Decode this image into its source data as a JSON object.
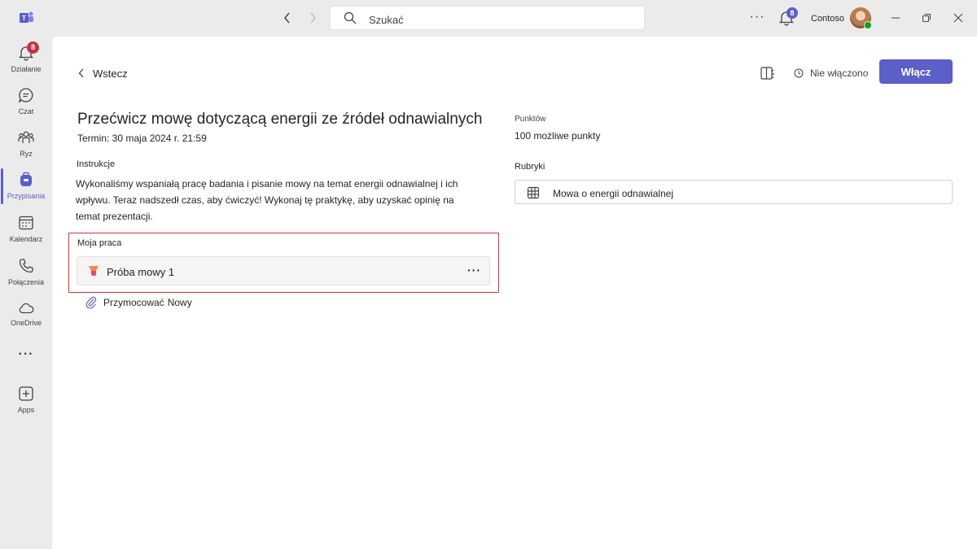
{
  "titlebar": {
    "search_placeholder": "Szukać",
    "notifications_count": "8",
    "org_name": "Contoso"
  },
  "rail": {
    "items": [
      {
        "label": "Działanie",
        "badge": "8"
      },
      {
        "label": "Czat"
      },
      {
        "label": "Ryz"
      },
      {
        "label": "Przypisania"
      },
      {
        "label": "Kalendarz"
      },
      {
        "label": "Połączenia"
      },
      {
        "label": "OneDrive"
      },
      {
        "label": "Apps"
      }
    ],
    "more_label": "···"
  },
  "header": {
    "back_label": "Wstecz",
    "status_label": "Nie włączono",
    "turn_in_label": "Włącz"
  },
  "assignment": {
    "title": "Przećwicz mowę dotyczącą energii ze źródeł odnawialnych",
    "due": "Termin: 30 maja 2024 r. 21:59",
    "instructions_label": "Instrukcje",
    "instructions_text": "Wykonaliśmy wspaniałą pracę badania i pisanie mowy na temat energii odnawialnej i ich wpływu. Teraz nadszedł czas, aby ćwiczyć! Wykonaj tę praktykę, aby uzyskać opinię na temat prezentacji.",
    "my_work_label": "Moja praca",
    "file_name": "Próba mowy 1",
    "attach_label": "Przymocować",
    "new_label": "Nowy"
  },
  "sidebar_info": {
    "points_label": "Punktów",
    "points_value": "100 możliwe punkty",
    "rubric_label": "Rubryki",
    "rubric_name": "Mowa o energii odnawialnej"
  },
  "colors": {
    "accent": "#5b5fc7",
    "highlight_border": "#d13438",
    "badge_red": "#c4314b"
  }
}
